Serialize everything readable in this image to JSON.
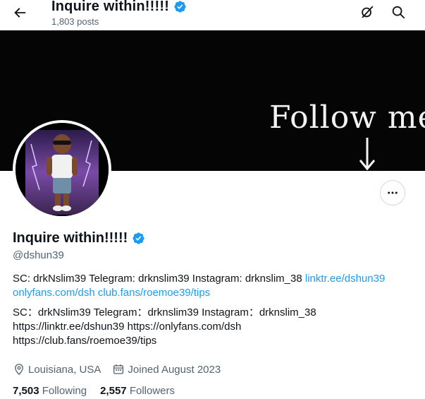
{
  "header": {
    "title": "Inquire within!!!!!",
    "posts": "1,803 posts"
  },
  "banner": {
    "text": "Follow me"
  },
  "profile": {
    "name": "Inquire within!!!!!",
    "handle": "@dshun39",
    "bio_line1_text": "SC: drkNslim39 Telegram: drknslim39 Instagram: drknslim_38 ",
    "bio_link1": "linktr.ee/dshun39",
    "bio_link2": "onlyfans.com/dsh",
    "bio_link3": "club.fans/roemoe39/tips",
    "bio2_line1": "SC：drkNslim39 Telegram：drknslim39 Instagram：drknslim_38",
    "bio2_line2": "https://linktr.ee/dshun39 https://onlyfans.com/dsh",
    "bio2_line3": "https://club.fans/roemoe39/tips",
    "location": "Louisiana, USA",
    "joined": "Joined August 2023",
    "following_count": "7,503",
    "following_label": "Following",
    "followers_count": "2,557",
    "followers_label": "Followers"
  },
  "icons": {
    "back": "arrow-left-icon",
    "grok": "grok-icon",
    "search": "search-icon",
    "more": "more-icon",
    "verified": "verified-badge-icon",
    "location": "location-pin-icon",
    "calendar": "calendar-icon"
  },
  "colors": {
    "accent": "#1d9bf0",
    "secondary_text": "#536471",
    "border": "#cfd9de"
  }
}
